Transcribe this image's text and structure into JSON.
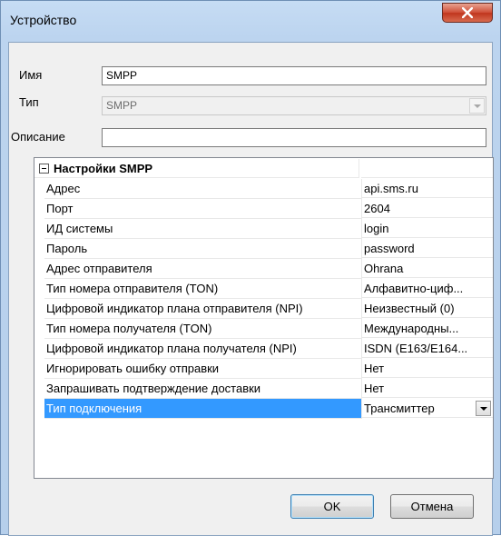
{
  "window": {
    "title": "Устройство"
  },
  "form": {
    "name_label": "Имя",
    "name_value": "SMPP",
    "type_label": "Тип",
    "type_value": "SMPP",
    "description_label": "Описание",
    "description_value": ""
  },
  "grid": {
    "category": "Настройки SMPP",
    "rows": [
      {
        "name": "Адрес",
        "value": "api.sms.ru"
      },
      {
        "name": "Порт",
        "value": "2604"
      },
      {
        "name": "ИД системы",
        "value": "login"
      },
      {
        "name": "Пароль",
        "value": "password"
      },
      {
        "name": "Адрес отправителя",
        "value": "Ohrana"
      },
      {
        "name": "Тип номера отправителя (TON)",
        "value": "Алфавитно-циф..."
      },
      {
        "name": "Цифровой индикатор плана отправителя (NPI)",
        "value": "Неизвестный (0)"
      },
      {
        "name": "Тип номера получателя (TON)",
        "value": "Международны..."
      },
      {
        "name": "Цифровой индикатор плана получателя (NPI)",
        "value": "ISDN (E163/E164..."
      },
      {
        "name": "Игнорировать ошибку отправки",
        "value": "Нет"
      },
      {
        "name": "Запрашивать подтверждение доставки",
        "value": "Нет"
      },
      {
        "name": "Тип подключения",
        "value": "Трансмиттер"
      }
    ]
  },
  "buttons": {
    "ok": "OK",
    "cancel": "Отмена"
  }
}
